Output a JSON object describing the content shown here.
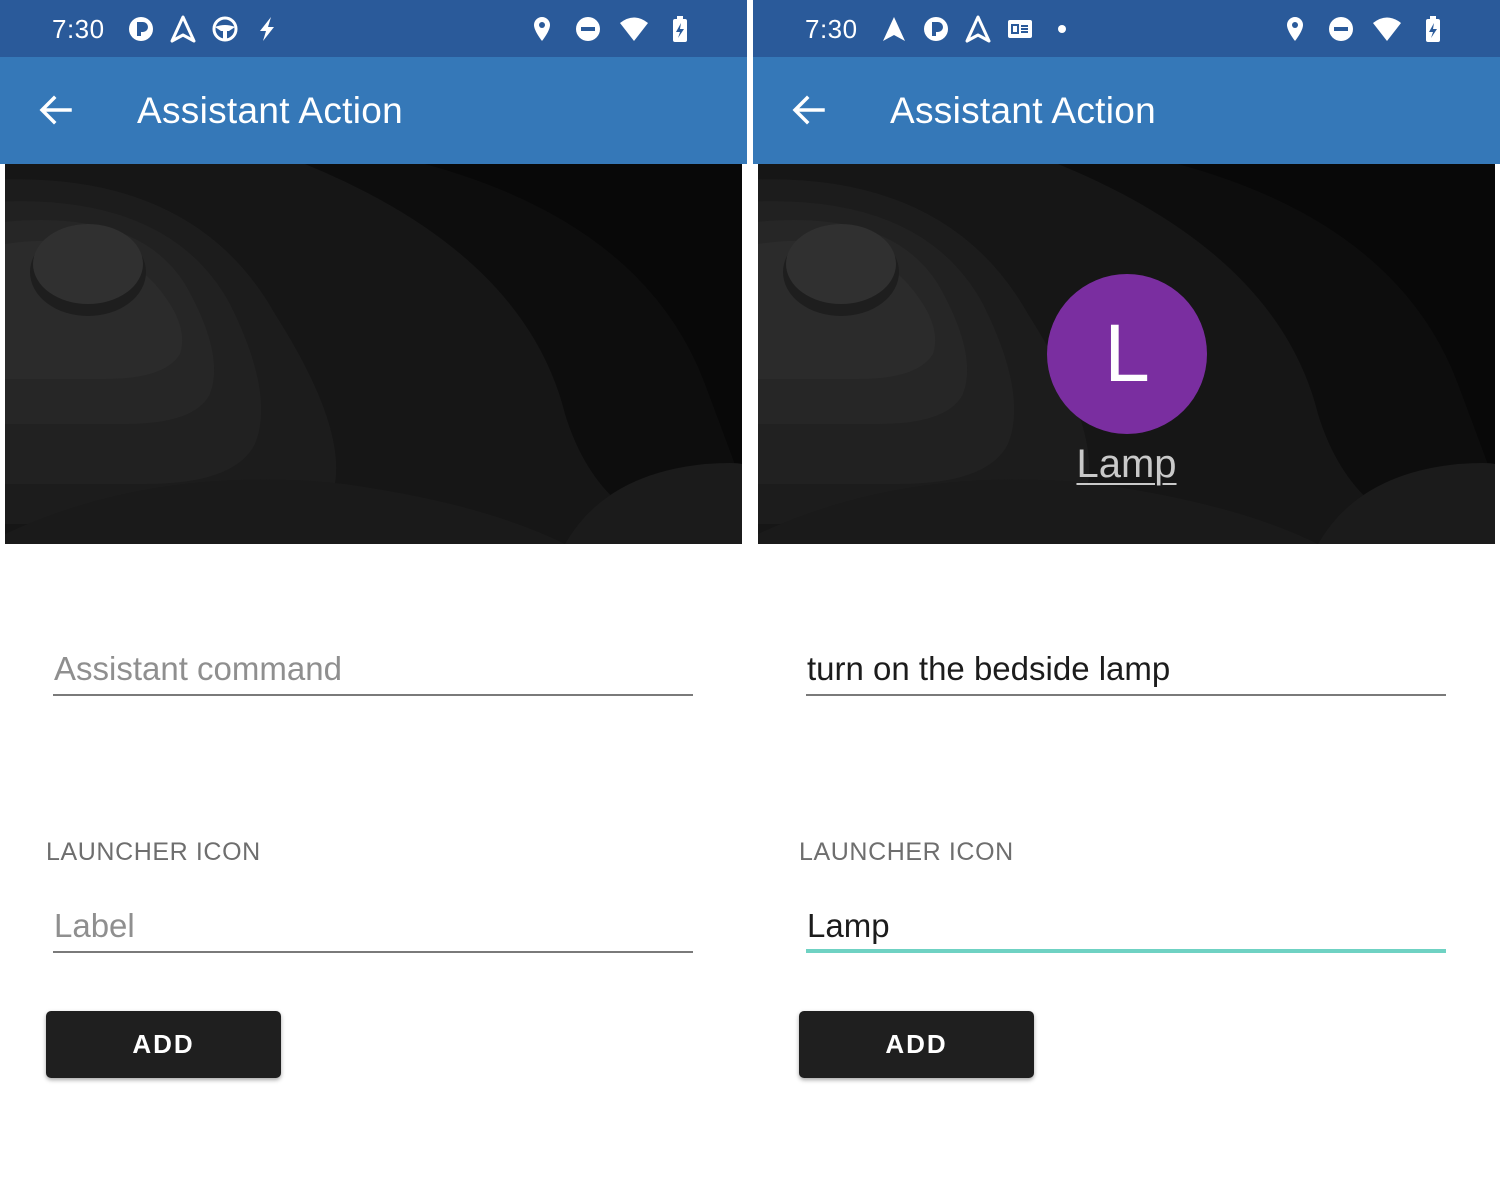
{
  "colors": {
    "status_bar": "#2a5a9a",
    "app_bar": "#3578b8",
    "avatar": "#7a2ea0",
    "focused_underline": "#6fd2c3",
    "button": "#1f1f1f"
  },
  "screens": [
    {
      "status_bar": {
        "time": "7:30",
        "left_icons": [
          "app-p-icon",
          "navigation-icon",
          "steering-wheel-icon",
          "flash-icon"
        ],
        "right_icons": [
          "location-icon",
          "do-not-disturb-icon",
          "wifi-icon",
          "battery-charging-icon"
        ]
      },
      "app_bar": {
        "title": "Assistant Action"
      },
      "hero": {
        "avatar_visible": false
      },
      "command_field": {
        "value": "",
        "placeholder": "Assistant command"
      },
      "section_title": "LAUNCHER ICON",
      "label_field": {
        "value": "",
        "placeholder": "Label",
        "focused": false
      },
      "add_button": {
        "label": "ADD"
      }
    },
    {
      "status_bar": {
        "time": "7:30",
        "left_icons": [
          "navigation-icon",
          "app-p-icon",
          "navigation-icon",
          "ge-icon",
          "dot-icon"
        ],
        "right_icons": [
          "location-icon",
          "do-not-disturb-icon",
          "wifi-icon",
          "battery-charging-icon"
        ]
      },
      "app_bar": {
        "title": "Assistant Action"
      },
      "hero": {
        "avatar_visible": true,
        "avatar_letter": "L",
        "avatar_label": "Lamp"
      },
      "command_field": {
        "value": "turn on the bedside lamp",
        "placeholder": ""
      },
      "section_title": "LAUNCHER ICON",
      "label_field": {
        "value": "Lamp",
        "placeholder": "",
        "focused": true
      },
      "add_button": {
        "label": "ADD"
      }
    }
  ]
}
